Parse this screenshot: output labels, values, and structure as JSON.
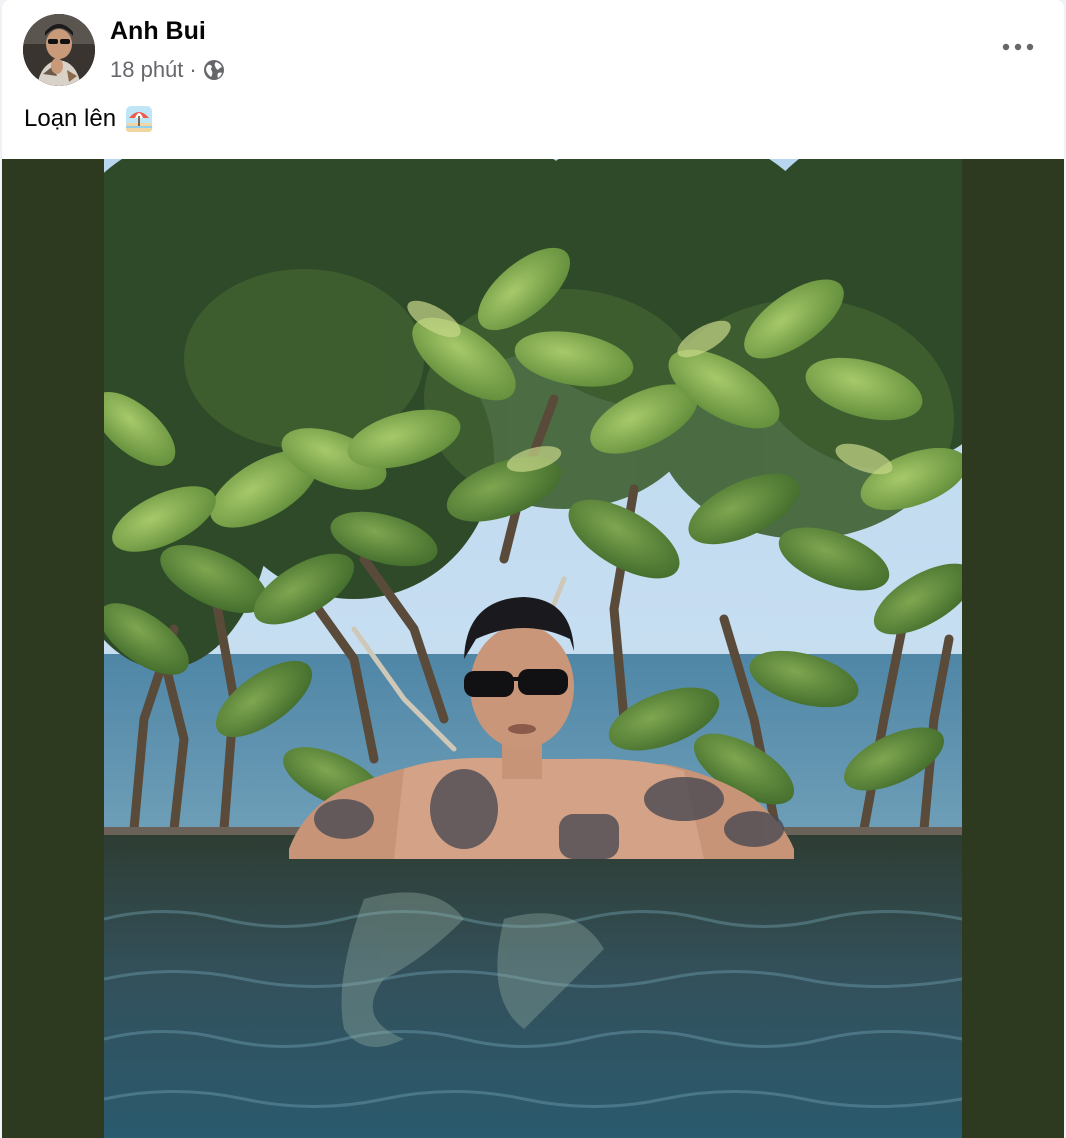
{
  "post": {
    "author_name": "Anh Bui",
    "timestamp": "18 phút",
    "separator": "·",
    "audience_icon": "globe-icon",
    "more_icon": "more-options-icon",
    "caption_text": "Loạn lên",
    "caption_emoji": "beach-umbrella-emoji",
    "photo_icon": "post-photo"
  },
  "colors": {
    "author_text": "#050505",
    "meta_text": "#65676b",
    "media_side_background": "#2e3a1f"
  }
}
